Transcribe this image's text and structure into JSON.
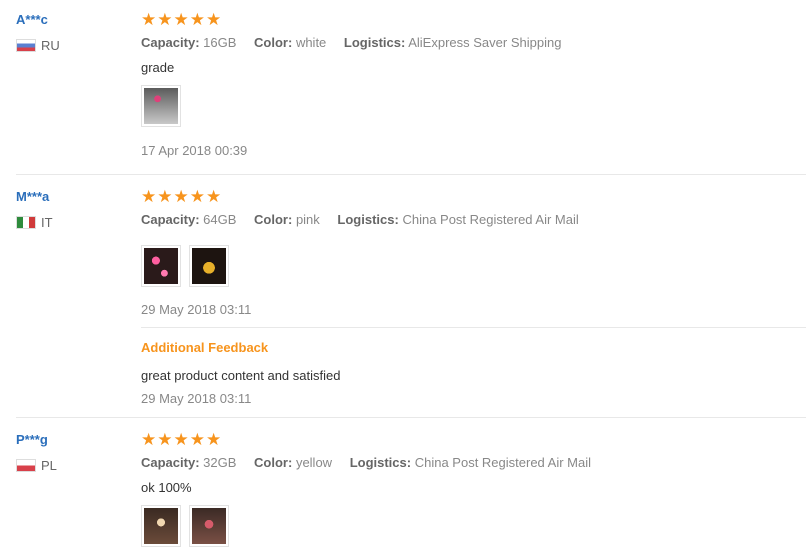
{
  "colors": {
    "accent_star": "#f7941d",
    "link_blue": "#2a6ebb",
    "additional_orange": "#f7941d"
  },
  "reviews": [
    {
      "user": "A***c",
      "country": "RU",
      "stars": 5,
      "capacity_label": "Capacity:",
      "capacity": "16GB",
      "color_label": "Color:",
      "color": "white",
      "logistics_label": "Logistics:",
      "logistics": "AliExpress Saver Shipping",
      "text": "grade",
      "date": "17 Apr 2018 00:39",
      "images": [
        "photo-thumbnail"
      ]
    },
    {
      "user": "M***a",
      "country": "IT",
      "stars": 5,
      "capacity_label": "Capacity:",
      "capacity": "64GB",
      "color_label": "Color:",
      "color": "pink",
      "logistics_label": "Logistics:",
      "logistics": "China Post Registered Air Mail",
      "text": "",
      "date": "29 May 2018 03:11",
      "images": [
        "photo-thumbnail",
        "photo-thumbnail"
      ],
      "additional": {
        "title": "Additional Feedback",
        "text": "great product content and satisfied",
        "date": "29 May 2018 03:11"
      }
    },
    {
      "user": "P***g",
      "country": "PL",
      "stars": 5,
      "capacity_label": "Capacity:",
      "capacity": "32GB",
      "color_label": "Color:",
      "color": "yellow",
      "logistics_label": "Logistics:",
      "logistics": "China Post Registered Air Mail",
      "text": "ok 100%",
      "images": [
        "photo-thumbnail",
        "photo-thumbnail"
      ]
    }
  ]
}
